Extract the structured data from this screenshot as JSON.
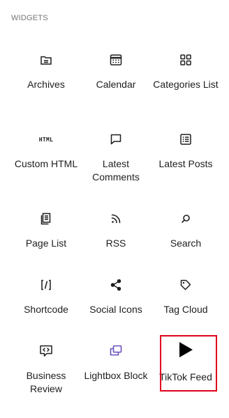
{
  "section": {
    "title": "Widgets"
  },
  "blocks": [
    {
      "label": "Archives",
      "icon": "archive-icon"
    },
    {
      "label": "Calendar",
      "icon": "calendar-icon"
    },
    {
      "label": "Categories List",
      "icon": "categories-icon"
    },
    {
      "label": "Custom HTML",
      "icon": "html-icon",
      "icon_text": "HTML"
    },
    {
      "label": "Latest Comments",
      "icon": "comment-icon"
    },
    {
      "label": "Latest Posts",
      "icon": "post-list-icon"
    },
    {
      "label": "Page List",
      "icon": "pages-icon"
    },
    {
      "label": "RSS",
      "icon": "rss-icon"
    },
    {
      "label": "Search",
      "icon": "search-icon"
    },
    {
      "label": "Shortcode",
      "icon": "shortcode-icon",
      "icon_text": "[/]"
    },
    {
      "label": "Social Icons",
      "icon": "share-icon"
    },
    {
      "label": "Tag Cloud",
      "icon": "tag-icon"
    },
    {
      "label": "Business Review",
      "icon": "code-bubble-icon"
    },
    {
      "label": "Lightbox Block",
      "icon": "lightbox-icon",
      "icon_color": "#6b4fbb"
    },
    {
      "label": "TikTok Feed",
      "icon": "play-icon"
    }
  ],
  "highlight_color": "#e0001b"
}
